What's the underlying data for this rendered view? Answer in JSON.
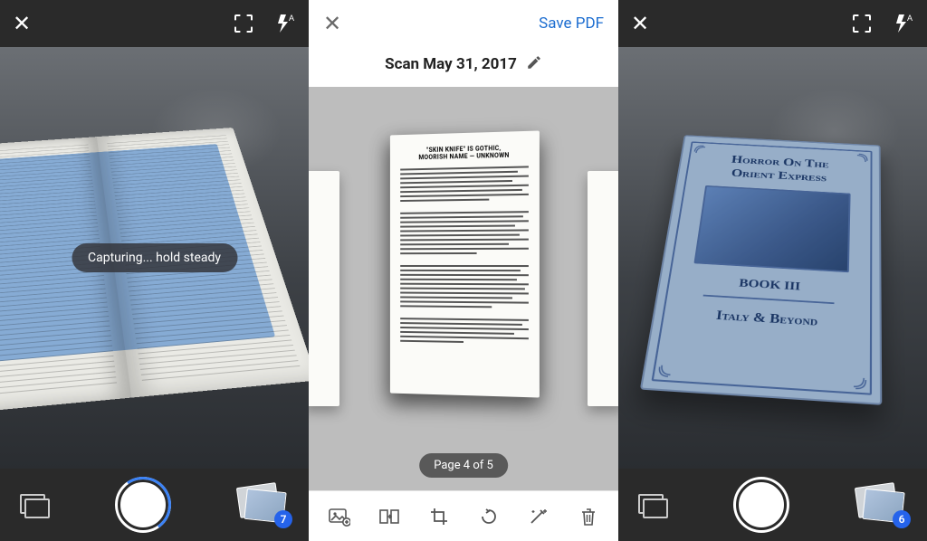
{
  "left_panel": {
    "toast": "Capturing... hold steady",
    "thumb_badge": "7"
  },
  "mid_panel": {
    "save_label": "Save PDF",
    "title": "Scan May 31, 2017",
    "page_indicator": "Page 4 of 5",
    "doc_heading_1": "\"SKIN KNIFE\" IS GOTHIC,",
    "doc_heading_2": "MOORISH NAME — UNKNOWN"
  },
  "right_panel": {
    "cover_title_line1": "Horror On The",
    "cover_title_line2": "Orient Express",
    "cover_book": "BOOK III",
    "cover_subtitle": "Italy & Beyond",
    "thumb_badge": "6"
  },
  "icons": {
    "close": "✕",
    "flash_mode": "A"
  }
}
